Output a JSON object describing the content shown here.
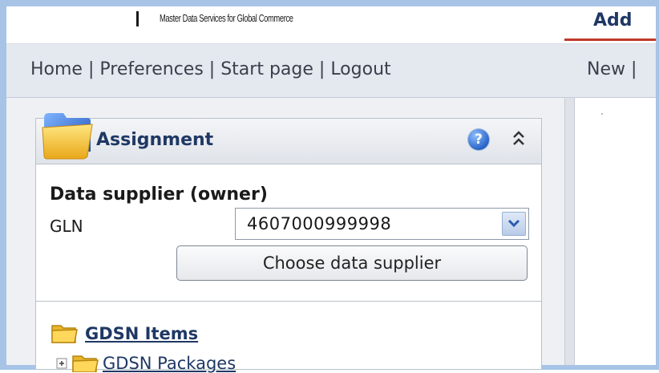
{
  "header": {
    "tagline": "Master Data Services for Global Commerce",
    "add_tab": "Add"
  },
  "nav": {
    "left_items": [
      "Home",
      "Preferences",
      "Start page",
      "Logout"
    ],
    "separator": "|",
    "right_items": [
      "New",
      "|"
    ]
  },
  "assignment_panel": {
    "title": "Assignment",
    "help_icon": "?",
    "collapse_icon": "double-chevron-up",
    "supplier_heading": "Data supplier (owner)",
    "gln_label": "GLN",
    "gln_value": "4607000999998",
    "choose_button": "Choose data supplier"
  },
  "tree": {
    "items": [
      {
        "label": "GDSN Items",
        "icon": "folder-icon"
      },
      {
        "label": "GDSN Packages",
        "icon": "folder-icon"
      }
    ]
  },
  "colors": {
    "frame": "#a7c4e6",
    "title_navy": "#1f3864",
    "add_underline": "#c0392b"
  }
}
